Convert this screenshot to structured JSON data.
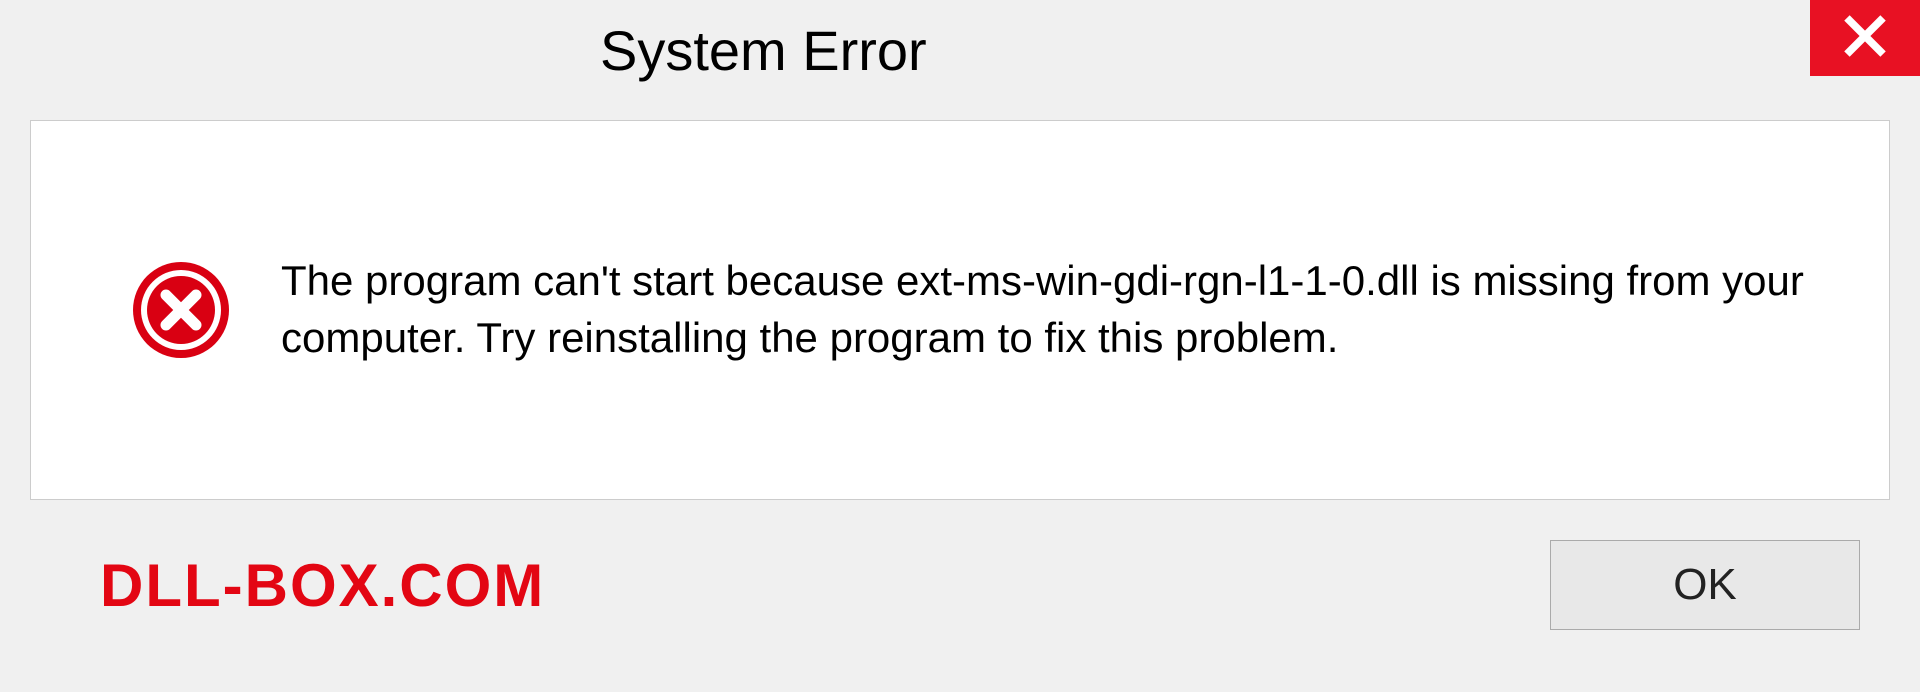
{
  "titlebar": {
    "title": "System Error"
  },
  "dialog": {
    "message": "The program can't start because ext-ms-win-gdi-rgn-l1-1-0.dll is missing from your computer. Try reinstalling the program to fix this problem."
  },
  "footer": {
    "watermark": "DLL-BOX.COM",
    "ok_label": "OK"
  },
  "colors": {
    "close_bg": "#e81123",
    "error_icon": "#d90012",
    "watermark": "#e30613"
  }
}
